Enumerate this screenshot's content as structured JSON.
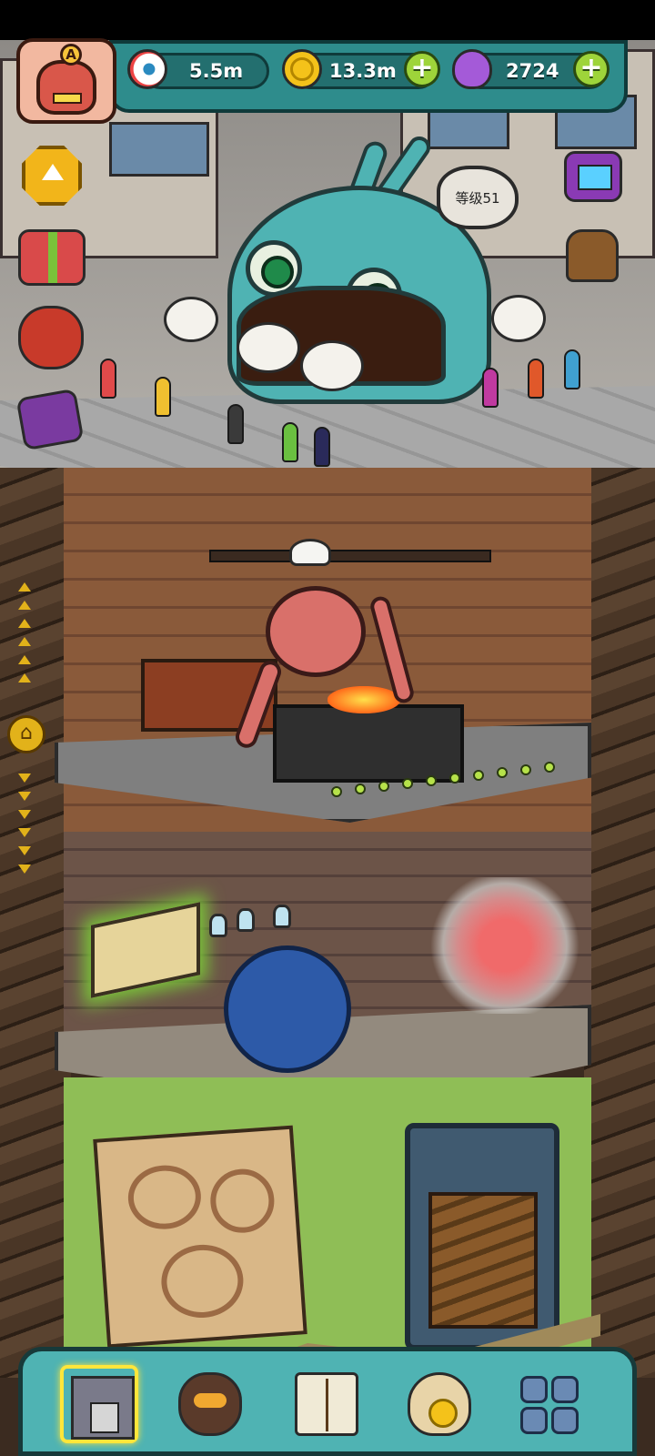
{
  "hud": {
    "eyeballs": "5.5m",
    "coins": "13.3m",
    "potions": "2724",
    "coins_plus": "+",
    "potions_plus": "+",
    "avatar_rank": "A"
  },
  "icons": {
    "eyeball": "eyeball-icon",
    "coin": "coin-icon",
    "potion": "potion-icon",
    "home": "home-icon"
  },
  "scene": {
    "restaurant_level": "等级51"
  },
  "nav": {
    "home_glyph": "⌂",
    "items": [
      "building",
      "monster",
      "book",
      "bag",
      "grid"
    ]
  },
  "colors": {
    "hud_teal": "#2e8c8c",
    "accent_green": "#9ed43a",
    "gold": "#f2b51a",
    "active_highlight": "#ffe63a"
  }
}
